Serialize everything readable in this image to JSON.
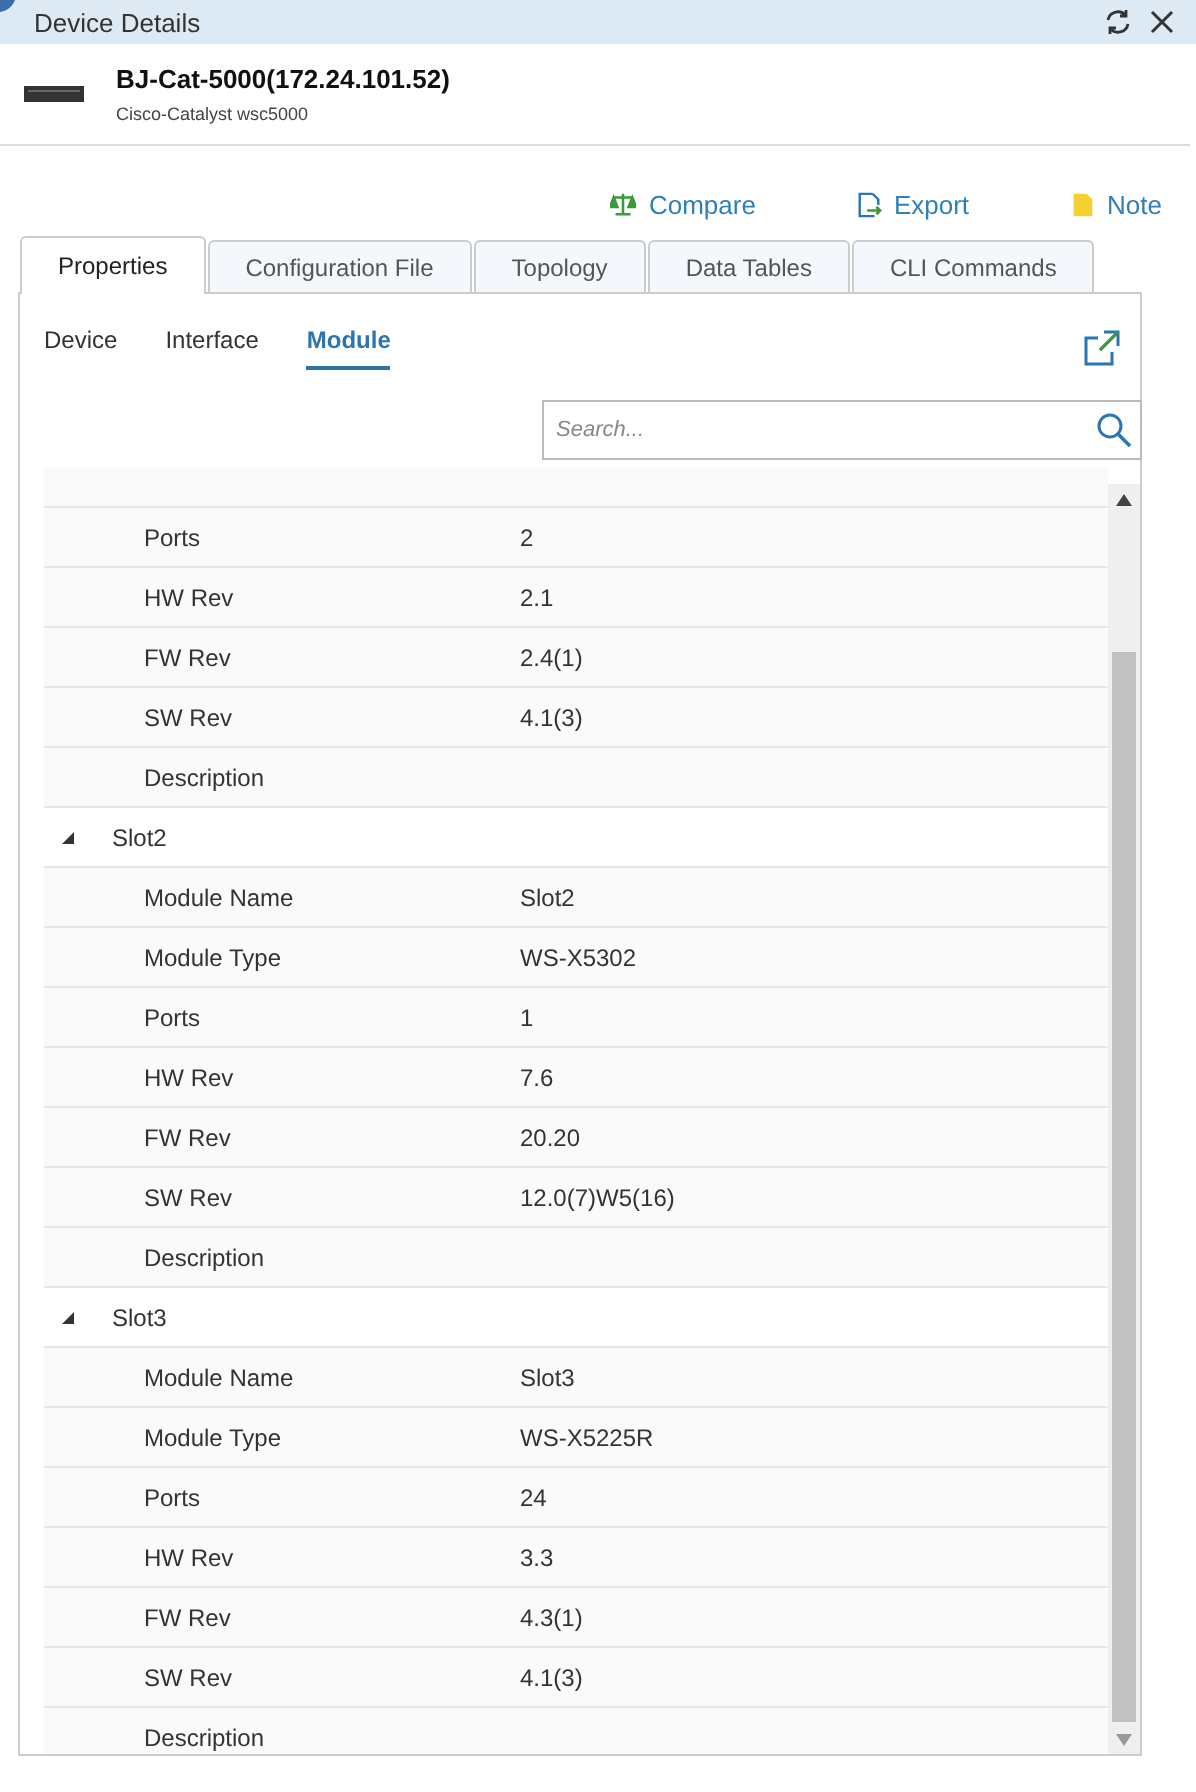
{
  "window": {
    "title": "Device Details"
  },
  "device": {
    "name": "BJ-Cat-5000(172.24.101.52)",
    "model": "Cisco-Catalyst wsc5000"
  },
  "actions": [
    {
      "kind": "compare",
      "label": "Compare"
    },
    {
      "kind": "export",
      "label": "Export"
    },
    {
      "kind": "note",
      "label": "Note"
    }
  ],
  "tabs": [
    {
      "label": "Properties",
      "selected": true
    },
    {
      "label": "Configuration File",
      "selected": false
    },
    {
      "label": "Topology",
      "selected": false
    },
    {
      "label": "Data Tables",
      "selected": false
    },
    {
      "label": "CLI Commands",
      "selected": false
    }
  ],
  "subtabs": [
    {
      "label": "Device",
      "selected": false
    },
    {
      "label": "Interface",
      "selected": false
    },
    {
      "label": "Module",
      "selected": true
    }
  ],
  "search": {
    "placeholder": "Search..."
  },
  "groups": [
    {
      "children": [
        {
          "property": "Ports",
          "value": "2"
        },
        {
          "property": "HW Rev",
          "value": "2.1"
        },
        {
          "property": "FW Rev",
          "value": "2.4(1)"
        },
        {
          "property": "SW Rev",
          "value": "4.1(3)"
        },
        {
          "property": "Description"
        }
      ]
    },
    {
      "name": "Slot2",
      "expanded": true,
      "children": [
        {
          "property": "Module Name",
          "value": "Slot2"
        },
        {
          "property": "Module Type",
          "value": "WS-X5302"
        },
        {
          "property": "Ports",
          "value": "1"
        },
        {
          "property": "HW Rev",
          "value": "7.6"
        },
        {
          "property": "FW Rev",
          "value": "20.20"
        },
        {
          "property": "SW Rev",
          "value": "12.0(7)W5(16)"
        },
        {
          "property": "Description"
        }
      ]
    },
    {
      "name": "Slot3",
      "expanded": true,
      "children": [
        {
          "property": "Module Name",
          "value": "Slot3"
        },
        {
          "property": "Module Type",
          "value": "WS-X5225R"
        },
        {
          "property": "Ports",
          "value": "24"
        },
        {
          "property": "HW Rev",
          "value": "3.3"
        },
        {
          "property": "FW Rev",
          "value": "4.3(1)"
        },
        {
          "property": "SW Rev",
          "value": "4.1(3)"
        },
        {
          "property": "Description"
        }
      ]
    }
  ]
}
